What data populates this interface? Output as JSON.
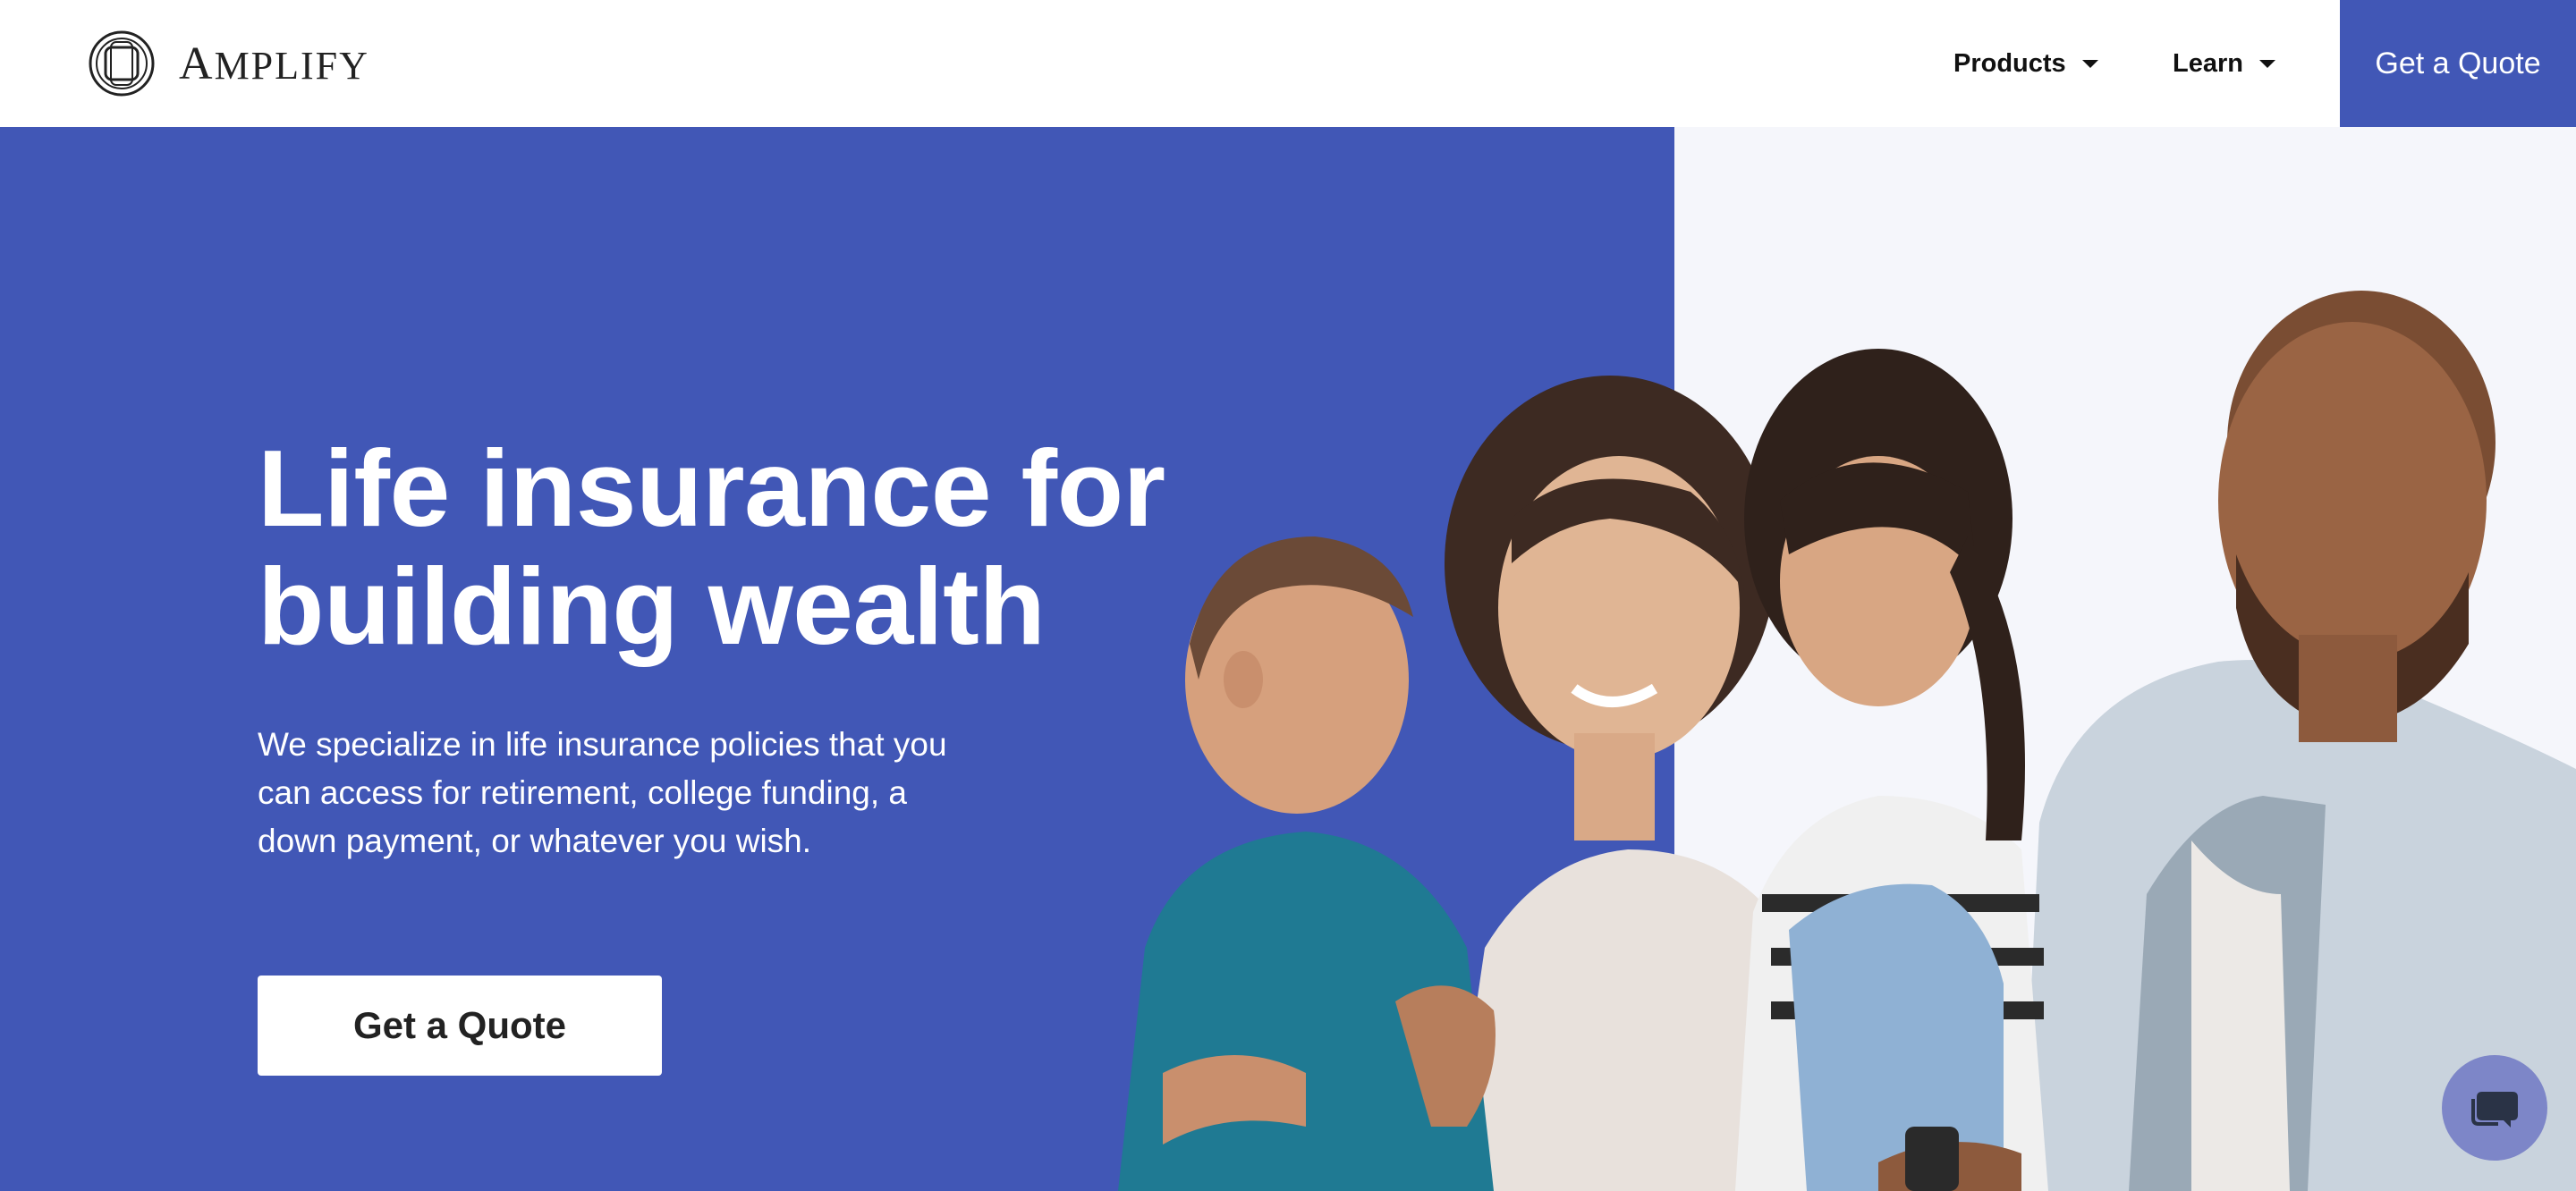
{
  "brand": {
    "name_initial": "A",
    "name_rest": "MPLIFY",
    "accent_color": "#4157b6"
  },
  "nav": {
    "products_label": "Products",
    "learn_label": "Learn",
    "cta_label": "Get a Quote"
  },
  "hero": {
    "title_line1": "Life insurance for",
    "title_line2": "building wealth",
    "subtitle_line1": "We specialize in life insurance policies that you",
    "subtitle_line2": "can access for retirement, college funding, a",
    "subtitle_line3": "down payment, or whatever you wish.",
    "cta_label": "Get a Quote"
  },
  "icons": {
    "logo": "amplify-logo-icon",
    "dropdown": "caret-down-icon",
    "chat": "chat-bubble-icon"
  }
}
